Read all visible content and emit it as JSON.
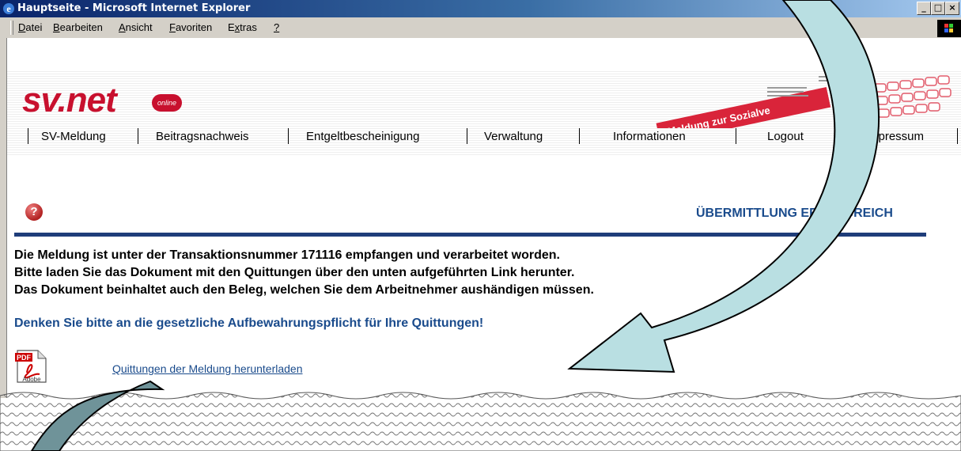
{
  "window": {
    "title": "Hauptseite - Microsoft Internet Explorer",
    "minimize": "_",
    "maximize": "□",
    "close": "×"
  },
  "menu": {
    "items": [
      {
        "label": "Datei",
        "key": "D",
        "rest": "atei"
      },
      {
        "label": "Bearbeiten",
        "key": "B",
        "rest": "earbeiten"
      },
      {
        "label": "Ansicht",
        "key": "A",
        "rest": "nsicht"
      },
      {
        "label": "Favoriten",
        "key": "F",
        "rest": "avoriten"
      },
      {
        "label": "Extras",
        "pre": "E",
        "key": "x",
        "rest": "tras"
      },
      {
        "label": "?",
        "key": "?",
        "rest": ""
      }
    ]
  },
  "site": {
    "logo_text": "sv.net",
    "logo_badge": "online",
    "banner_text": "Meldung zur Sozialve",
    "nav": [
      "SV-Meldung",
      "Beitragsnachweis",
      "Entgeltbescheinigung",
      "Verwaltung",
      "Informationen",
      "Logout",
      "mpressum"
    ]
  },
  "page": {
    "status_title": "ÜBERMITTLUNG ERFOLGREICH",
    "messages": [
      "Die Meldung ist unter der Transaktionsnummer 171116 empfangen und verarbeitet worden.",
      "Bitte laden Sie das Dokument mit den Quittungen über den unten aufgeführten Link herunter.",
      "Das Dokument beinhaltet auch den Beleg, welchen Sie dem Arbeitnehmer aushändigen müssen."
    ],
    "notice": "Denken Sie bitte an die gesetzliche Aufbewahrungspflicht für Ihre Quittungen!",
    "download_link": "Quittungen der Meldung herunterladen",
    "pdf_label_top": "PDF",
    "pdf_label_bottom": "Adobe"
  },
  "colors": {
    "accent": "#1a4b8c",
    "brand": "#c8102e",
    "arrow": "#b9dfe2"
  }
}
